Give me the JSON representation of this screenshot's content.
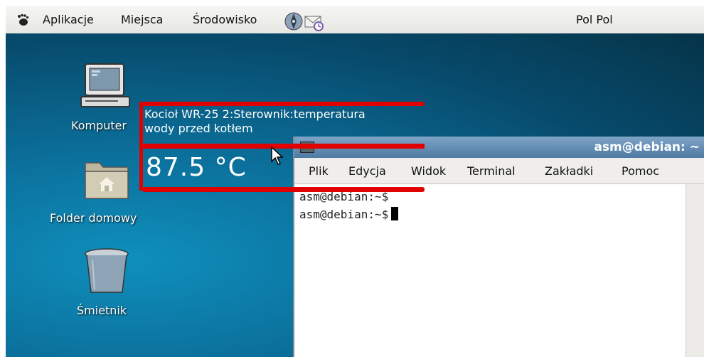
{
  "panel": {
    "menu": [
      {
        "label": "Aplikacje"
      },
      {
        "label": "Miejsca"
      },
      {
        "label": "Środowisko"
      }
    ],
    "keyboard": "Pol Pol"
  },
  "desktop": {
    "icons": [
      {
        "label": "Komputer",
        "icon": "computer-icon"
      },
      {
        "label": "Folder domowy",
        "icon": "home-folder-icon"
      },
      {
        "label": "Śmietnik",
        "icon": "trash-icon"
      }
    ]
  },
  "tooltip": {
    "line1": "Kocioł WR-25 2:Sterownik:temperatura",
    "line2": "wody przed kotłem",
    "value": "87.5 °C",
    "highlight_color": "#e10000"
  },
  "terminal": {
    "title": "asm@debian: ~",
    "menu": [
      {
        "label": "Plik"
      },
      {
        "label": "Edycja"
      },
      {
        "label": "Widok"
      },
      {
        "label": "Terminal"
      },
      {
        "label": "Zakładki"
      },
      {
        "label": "Pomoc"
      }
    ],
    "lines": [
      "asm@debian:~$",
      "asm@debian:~$"
    ]
  },
  "colors": {
    "desktop": "#0b6e99",
    "titlebar": "#4f7aa3"
  }
}
